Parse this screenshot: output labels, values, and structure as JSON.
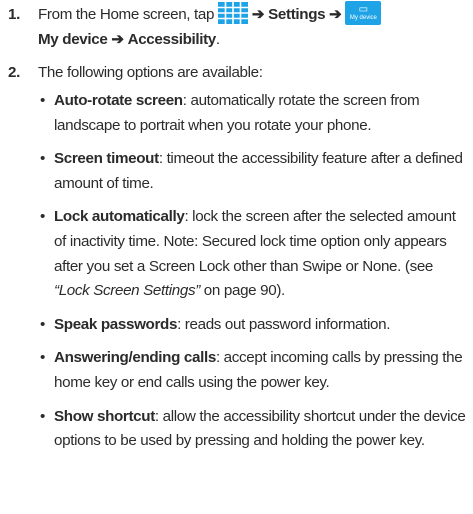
{
  "steps": [
    {
      "number": "1.",
      "prefix": "From the Home screen, tap",
      "arrow1": "➔",
      "settings": "Settings",
      "arrow2": "➔",
      "device_icon_label": "My device",
      "line2_bold": "My device",
      "arrow3": "➔",
      "accessibility": "Accessibility",
      "end": "."
    },
    {
      "number": "2.",
      "text": "The following options are available:"
    }
  ],
  "options": [
    {
      "term": "Auto-rotate screen",
      "desc": ": automatically rotate the screen from landscape to portrait when you rotate your phone."
    },
    {
      "term": "Screen timeout",
      "desc": ": timeout the accessibility feature after a defined amount of time."
    },
    {
      "term": "Lock automatically",
      "desc": ":  lock the screen after the selected amount of inactivity time. Note: Secured lock time option only appears after you set a Screen Lock other than Swipe or None. (see ",
      "ref": "“Lock Screen Settings”",
      "tail": " on page 90)."
    },
    {
      "term": "Speak passwords",
      "desc": ": reads out password information."
    },
    {
      "term": "Answering/ending calls",
      "desc": ": accept incoming calls by pressing the home key or end calls using the power key."
    },
    {
      "term": "Show shortcut",
      "desc": ": allow the accessibility shortcut under the device options to be used by pressing and holding the power key."
    }
  ],
  "colors": {
    "text": "#2b2b2b",
    "apps_icon": "#1ea3e6",
    "device_icon": "#1ea3e6"
  },
  "icons": {
    "apps": "apps-grid-icon",
    "device": "my-device-icon"
  }
}
